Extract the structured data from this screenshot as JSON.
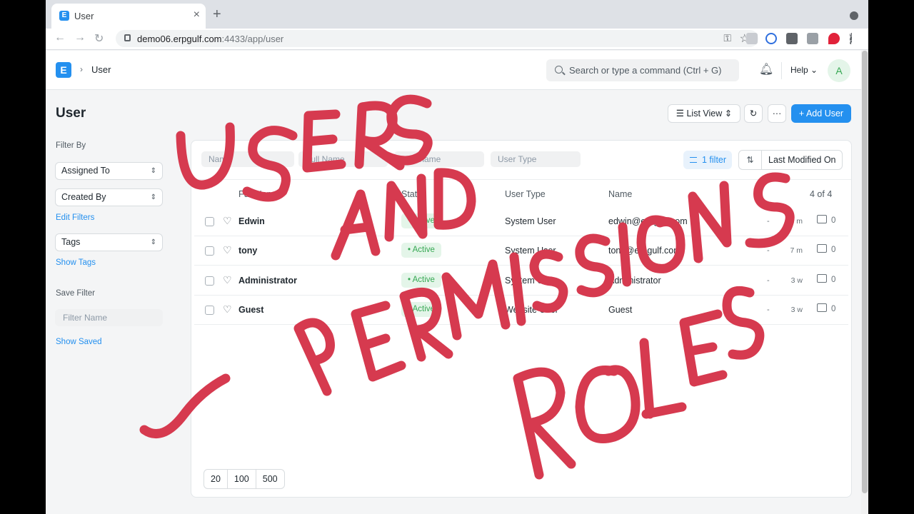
{
  "browser": {
    "tab_title": "User",
    "url_host": "demo06.erpgulf.com",
    "url_rest": ":4433/app/user"
  },
  "navbar": {
    "logo": "E",
    "breadcrumb": "User",
    "search_placeholder": "Search or type a command (Ctrl + G)",
    "help": "Help",
    "avatar": "A"
  },
  "page": {
    "title": "User",
    "list_view": "List View",
    "add_button": "+ Add User"
  },
  "sidebar": {
    "filter_by": "Filter By",
    "assigned_to": "Assigned To",
    "created_by": "Created By",
    "edit_filters": "Edit Filters",
    "tags": "Tags",
    "show_tags": "Show Tags",
    "save_filter": "Save Filter",
    "filter_name_placeholder": "Filter Name",
    "show_saved": "Show Saved"
  },
  "list": {
    "filters": {
      "name": "Name",
      "full_name": "Full Name",
      "username": "Username",
      "user_type": "User Type"
    },
    "filter_button": "1 filter",
    "sort_label": "Last Modified On",
    "headers": {
      "full_name": "Full Name",
      "status": "Status",
      "user_type": "User Type",
      "name": "Name",
      "count": "4 of 4"
    },
    "rows": [
      {
        "full_name": "Edwin",
        "status": "Active",
        "user_type": "System User",
        "name": "edwin@erpgulf.com",
        "dash": "-",
        "time": "5 m",
        "comments": "0"
      },
      {
        "full_name": "tony",
        "status": "Active",
        "user_type": "System User",
        "name": "tony@erpgulf.com",
        "dash": "-",
        "time": "7 m",
        "comments": "0"
      },
      {
        "full_name": "Administrator",
        "status": "Active",
        "user_type": "System User",
        "name": "Administrator",
        "dash": "-",
        "time": "3 w",
        "comments": "0"
      },
      {
        "full_name": "Guest",
        "status": "Active",
        "user_type": "Website User",
        "name": "Guest",
        "dash": "-",
        "time": "3 w",
        "comments": "0"
      }
    ],
    "page_sizes": [
      "20",
      "100",
      "500"
    ]
  },
  "overlay": {
    "color": "#d63a4f",
    "words": [
      "USERS",
      "AND",
      "PERMISSIONS",
      "ROLES"
    ]
  }
}
